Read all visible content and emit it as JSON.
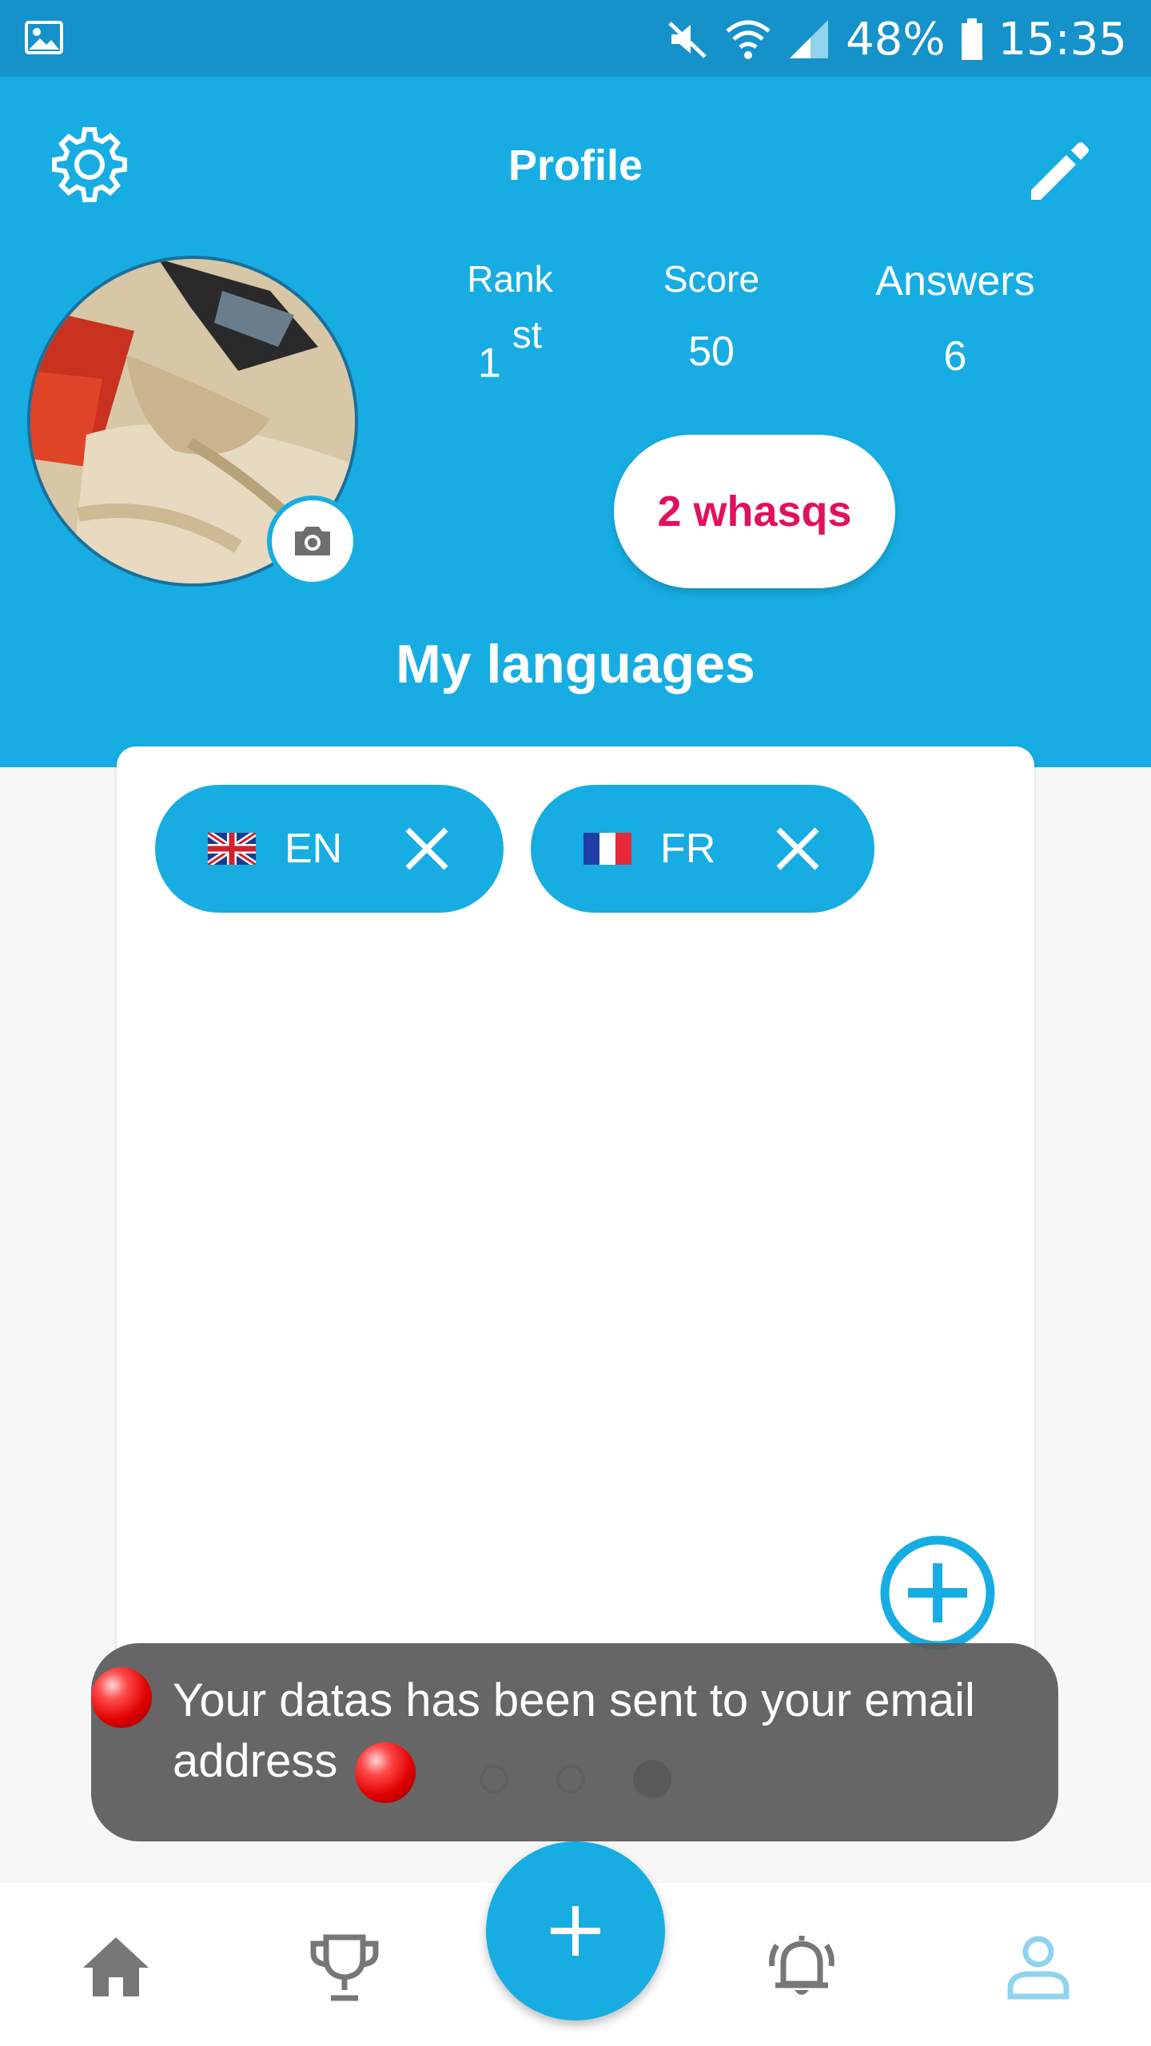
{
  "status_bar": {
    "battery": "48%",
    "time": "15:35"
  },
  "header": {
    "title": "Profile"
  },
  "stats": {
    "rank_label": "Rank",
    "rank_value": "1",
    "rank_suffix": "st",
    "score_label": "Score",
    "score_value": "50",
    "answers_label": "Answers",
    "answers_value": "6"
  },
  "whasqs_button": "2 whasqs",
  "languages": {
    "title": "My languages",
    "items": [
      {
        "code": "EN"
      },
      {
        "code": "FR"
      }
    ]
  },
  "toast": {
    "message": "Your datas has been sent to your email address"
  },
  "pager": {
    "count": 3,
    "active_index": 2
  },
  "bottom_nav": {
    "items": [
      {
        "icon": "home-icon"
      },
      {
        "icon": "trophy-icon"
      },
      {
        "icon": "plus-icon"
      },
      {
        "icon": "bell-icon"
      },
      {
        "icon": "profile-icon"
      }
    ],
    "active": "profile-icon"
  },
  "colors": {
    "primary": "#17ade3",
    "status_bar": "#1592c9",
    "accent": "#e0115f",
    "toast_bg": "#5a5a5a"
  }
}
